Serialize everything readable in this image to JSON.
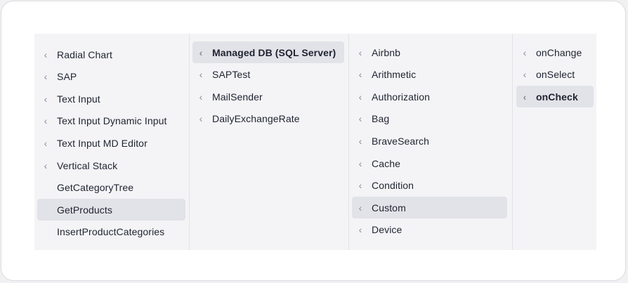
{
  "columns": [
    {
      "items": [
        {
          "label": "Radial Chart",
          "chevron": true,
          "selected": false
        },
        {
          "label": "SAP",
          "chevron": true,
          "selected": false
        },
        {
          "label": "Text Input",
          "chevron": true,
          "selected": false
        },
        {
          "label": "Text Input Dynamic Input",
          "chevron": true,
          "selected": false
        },
        {
          "label": "Text Input MD Editor",
          "chevron": true,
          "selected": false
        },
        {
          "label": "Vertical Stack",
          "chevron": true,
          "selected": false
        },
        {
          "label": "GetCategoryTree",
          "chevron": false,
          "selected": false
        },
        {
          "label": "GetProducts",
          "chevron": false,
          "selected": true
        },
        {
          "label": "InsertProductCategories",
          "chevron": false,
          "selected": false
        }
      ]
    },
    {
      "items": [
        {
          "label": "Managed DB (SQL Server)",
          "chevron": true,
          "selected": true
        },
        {
          "label": "SAPTest",
          "chevron": true,
          "selected": false
        },
        {
          "label": "MailSender",
          "chevron": true,
          "selected": false
        },
        {
          "label": "DailyExchangeRate",
          "chevron": true,
          "selected": false
        }
      ]
    },
    {
      "items": [
        {
          "label": "Airbnb",
          "chevron": true,
          "selected": false
        },
        {
          "label": "Arithmetic",
          "chevron": true,
          "selected": false
        },
        {
          "label": "Authorization",
          "chevron": true,
          "selected": false
        },
        {
          "label": "Bag",
          "chevron": true,
          "selected": false
        },
        {
          "label": "BraveSearch",
          "chevron": true,
          "selected": false
        },
        {
          "label": "Cache",
          "chevron": true,
          "selected": false
        },
        {
          "label": "Condition",
          "chevron": true,
          "selected": false
        },
        {
          "label": "Custom",
          "chevron": true,
          "selected": true
        },
        {
          "label": "Device",
          "chevron": true,
          "selected": false
        }
      ]
    },
    {
      "items": [
        {
          "label": "onChange",
          "chevron": true,
          "selected": false
        },
        {
          "label": "onSelect",
          "chevron": true,
          "selected": false
        },
        {
          "label": "onCheck",
          "chevron": true,
          "selected": true
        }
      ]
    }
  ],
  "icons": {
    "chevron": "chevron-left-icon",
    "chevron_glyph": "‹"
  },
  "colors": {
    "selected_bg": "#e2e3e8",
    "text": "#1f2330",
    "chevron": "#8a8d96",
    "panel_bg": "#f4f4f6"
  }
}
